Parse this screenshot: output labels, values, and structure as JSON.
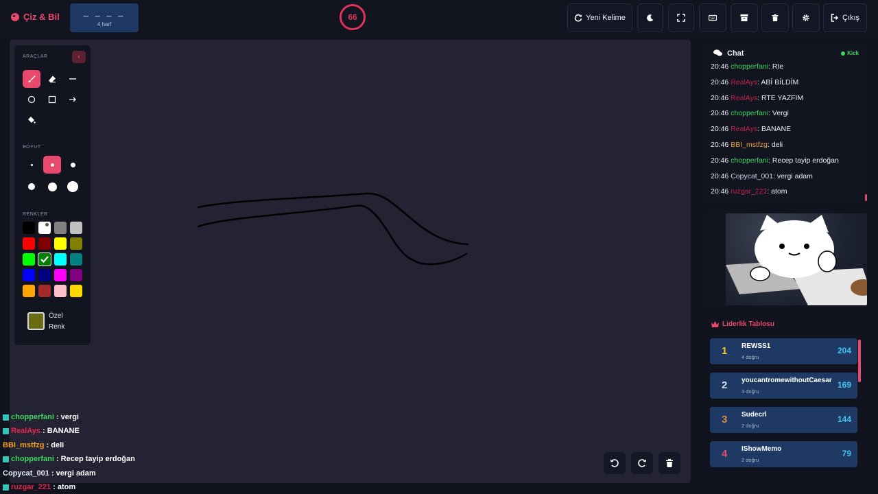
{
  "app": {
    "name": "Çiz & Bil"
  },
  "word": {
    "blanks": "– – – –",
    "hint": "4 harf"
  },
  "timer": {
    "value": "66"
  },
  "toolbar": {
    "new_word_label": "Yeni Kelime",
    "logout_label": "Çıkış",
    "icons": [
      "moon-icon",
      "fullscreen-icon",
      "keyboard-icon",
      "archive-icon",
      "trash-icon",
      "gear-icon"
    ]
  },
  "tools": {
    "tools_label": "ARAÇLAR",
    "size_label": "BOYUT",
    "colors_label": "RENKLER",
    "custom_color_label_1": "Özel",
    "custom_color_label_2": "Renk",
    "selected_color": "#008000",
    "custom_color": "#6b6b13",
    "palette": [
      "#000000",
      "#ffffff",
      "#808080",
      "#c0c0c0",
      "#ff0000",
      "#800000",
      "#ffff00",
      "#808000",
      "#00ff00",
      "#008000",
      "#00ffff",
      "#008080",
      "#0000ff",
      "#000080",
      "#ff00ff",
      "#800080",
      "#ffa500",
      "#a52a2a",
      "#ffc0cb",
      "#ffd700"
    ]
  },
  "chat": {
    "title": "Chat",
    "platform": "Kick",
    "messages": [
      {
        "time": "20:46",
        "user": "chopperfani",
        "text": ": Rte",
        "color": "#3ed75d"
      },
      {
        "time": "20:46",
        "user": "RealAys",
        "text": ": ABİ BİLDİM",
        "color": "#c2274b"
      },
      {
        "time": "20:46",
        "user": "RealAys",
        "text": ": RTE YAZFIM",
        "color": "#c2274b"
      },
      {
        "time": "20:46",
        "user": "chopperfani",
        "text": ": Vergi",
        "color": "#3ed75d"
      },
      {
        "time": "20:46",
        "user": "RealAys",
        "text": ": BANANE",
        "color": "#c2274b"
      },
      {
        "time": "20:46",
        "user": "BBI_mstfzg",
        "text": ": deli",
        "color": "#e8a23a"
      },
      {
        "time": "20:46",
        "user": "chopperfani",
        "text": ": Recep tayip erdoğan",
        "color": "#3ed75d"
      },
      {
        "time": "20:46",
        "user": "Copycat_001",
        "text": ": vergi adam",
        "color": "#d0d6e4"
      },
      {
        "time": "20:46",
        "user": "ruzgar_221",
        "text": ": atom",
        "color": "#c2274b"
      }
    ]
  },
  "overlay": {
    "messages": [
      {
        "user": "chopperfani",
        "text": ": vergi",
        "color": "#3ed75d",
        "badge": true
      },
      {
        "user": "RealAys",
        "text": ": BANANE",
        "color": "#e8244b",
        "badge": true
      },
      {
        "user": "BBI_mstfzg",
        "text": ": deli",
        "color": "#f0a020",
        "badge": false
      },
      {
        "user": "chopperfani",
        "text": ": Recep tayip erdoğan",
        "color": "#3ed75d",
        "badge": true
      },
      {
        "user": "Copycat_001",
        "text": ": vergi adam",
        "color": "#e8ecf4",
        "badge": false
      },
      {
        "user": "ruzgar_221",
        "text": ": atom",
        "color": "#e8244b",
        "badge": true
      }
    ]
  },
  "leaderboard": {
    "title": "Liderlik Tablosu",
    "rows": [
      {
        "rank": "1",
        "name": "REWSS1",
        "sub": "4 doğru",
        "score": "204",
        "rank_color": "#f5c518"
      },
      {
        "rank": "2",
        "name": "youcantromewithoutCaesar",
        "sub": "3 doğru",
        "score": "169",
        "rank_color": "#d6dce8"
      },
      {
        "rank": "3",
        "name": "Sudecrl",
        "sub": "2 doğru",
        "score": "144",
        "rank_color": "#d98c3a"
      },
      {
        "rank": "4",
        "name": "IShowMemo",
        "sub": "2 doğru",
        "score": "79",
        "rank_color": "#e8496d"
      }
    ]
  },
  "colors": {
    "accent": "#e8496d",
    "card": "#1e3a64",
    "canvas": "#232334"
  }
}
